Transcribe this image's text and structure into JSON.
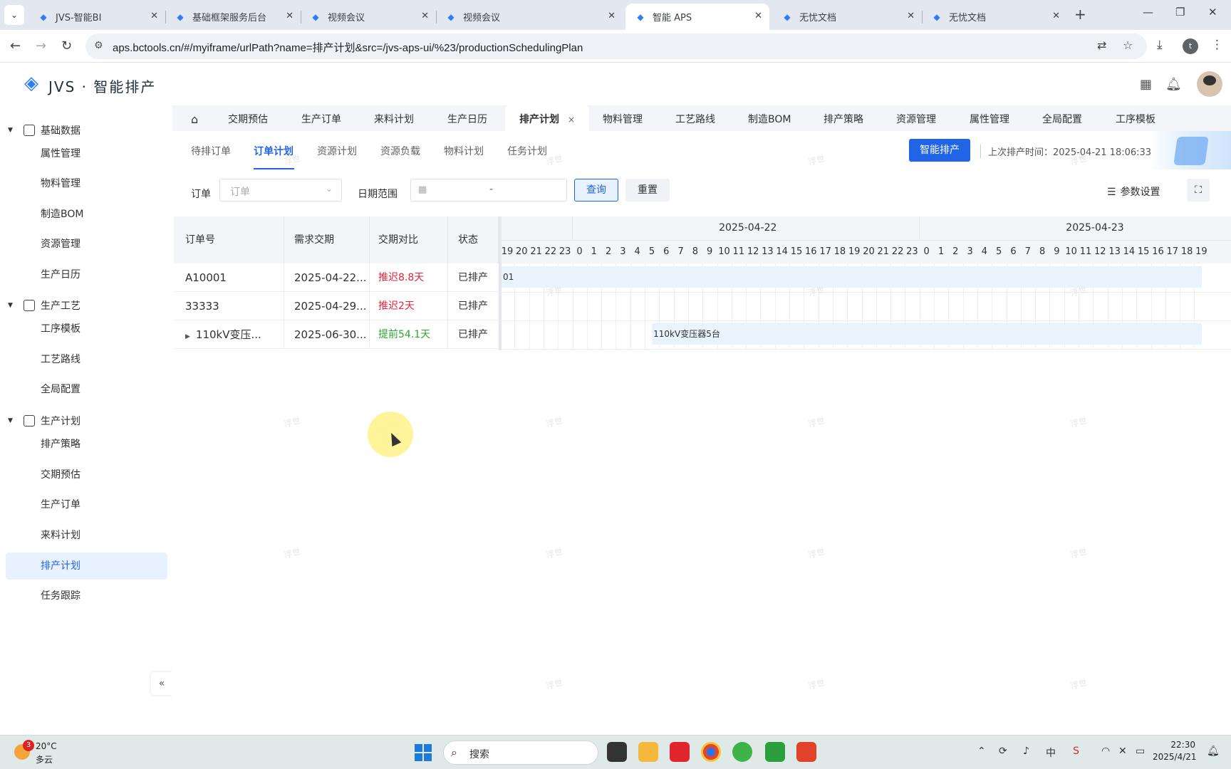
{
  "browser": {
    "tabs": [
      {
        "title": "JVS-智能BI",
        "active": false
      },
      {
        "title": "基础框架服务后台",
        "active": false
      },
      {
        "title": "视频会议",
        "active": false
      },
      {
        "title": "视频会议",
        "active": false
      },
      {
        "title": "智能 APS",
        "active": true
      },
      {
        "title": "无忧文档",
        "active": false
      },
      {
        "title": "无忧文档",
        "active": false
      }
    ],
    "url": "aps.bctools.cn/#/myiframe/urlPath?name=排产计划&src=/jvs-aps-ui/%23/productionSchedulingPlan",
    "profile_initial": "t"
  },
  "app": {
    "logo_text": "JVS · 智能排产"
  },
  "sidebar": {
    "groups": [
      {
        "label": "基础数据",
        "icon": "table-icon",
        "items": [
          "属性管理",
          "物料管理",
          "制造BOM",
          "资源管理",
          "生产日历"
        ]
      },
      {
        "label": "生产工艺",
        "icon": "process-icon",
        "items": [
          "工序模板",
          "工艺路线",
          "全局配置"
        ]
      },
      {
        "label": "生产计划",
        "icon": "calendar-icon",
        "items": [
          "排产策略",
          "交期预估",
          "生产订单",
          "来料计划",
          "排产计划",
          "任务跟踪"
        ]
      }
    ],
    "active_item": "排产计划",
    "collapse_label": "«"
  },
  "page_tabs": {
    "items": [
      "交期预估",
      "生产订单",
      "来料计划",
      "生产日历",
      "排产计划",
      "物料管理",
      "工艺路线",
      "制造BOM",
      "排产策略",
      "资源管理",
      "属性管理",
      "全局配置",
      "工序模板"
    ],
    "active": "排产计划",
    "close_glyph": "×"
  },
  "sub_tabs": {
    "items": [
      "待排订单",
      "订单计划",
      "资源计划",
      "资源负载",
      "物料计划",
      "任务计划"
    ],
    "active": "订单计划"
  },
  "actions": {
    "smart_schedule": "智能排产",
    "last_schedule_time": "上次排产时间：2025-04-21 18:06:33"
  },
  "filters": {
    "order_label": "订单",
    "order_placeholder": "订单",
    "date_range_label": "日期范围",
    "date_range_separator": "-",
    "query_button": "查询",
    "reset_button": "重置",
    "param_settings": "参数设置"
  },
  "table": {
    "columns": [
      "订单号",
      "需求交期",
      "交期对比",
      "状态"
    ],
    "rows": [
      {
        "order_no": "A10001",
        "due": "2025-04-22...",
        "compare": "推迟8.8天",
        "compare_type": "delay",
        "status": "已排产",
        "expandable": false
      },
      {
        "order_no": "33333",
        "due": "2025-04-29...",
        "compare": "推迟2天",
        "compare_type": "delay",
        "status": "已排产",
        "expandable": false
      },
      {
        "order_no": "110kV变压...",
        "due": "2025-06-30...",
        "compare": "提前54.1天",
        "compare_type": "early",
        "status": "已排产",
        "expandable": true
      }
    ]
  },
  "gantt": {
    "dates": [
      "2025-04-22",
      "2025-04-23"
    ],
    "hours": [
      "19",
      "20",
      "21",
      "22",
      "23",
      "0",
      "1",
      "2",
      "3",
      "4",
      "5",
      "6",
      "7",
      "8",
      "9",
      "10",
      "11",
      "12",
      "13",
      "14",
      "15",
      "16",
      "17",
      "18",
      "19",
      "20",
      "21",
      "22",
      "23",
      "0",
      "1",
      "2",
      "3",
      "4",
      "5",
      "6",
      "7",
      "8",
      "9",
      "10",
      "11",
      "12",
      "13",
      "14",
      "15",
      "16",
      "17",
      "18",
      "19"
    ],
    "bars": [
      {
        "row": 0,
        "label": "01",
        "start_hour_index": 0,
        "end_hour_index": 48.5
      },
      {
        "row": 2,
        "label": "110kV变压器5台",
        "start_hour_index": 10.5,
        "end_hour_index": 48.5
      }
    ]
  },
  "watermark": "浮世",
  "taskbar": {
    "weather_badge": "3",
    "temperature": "20°C",
    "condition": "多云",
    "search_placeholder": "搜索",
    "ime": "中",
    "time": "22:30",
    "date": "2025/4/21"
  },
  "colors": {
    "primary": "#2264e6",
    "delay": "#e0243c",
    "early": "#2aa831",
    "gantt_bar": "#e8f3fd"
  }
}
